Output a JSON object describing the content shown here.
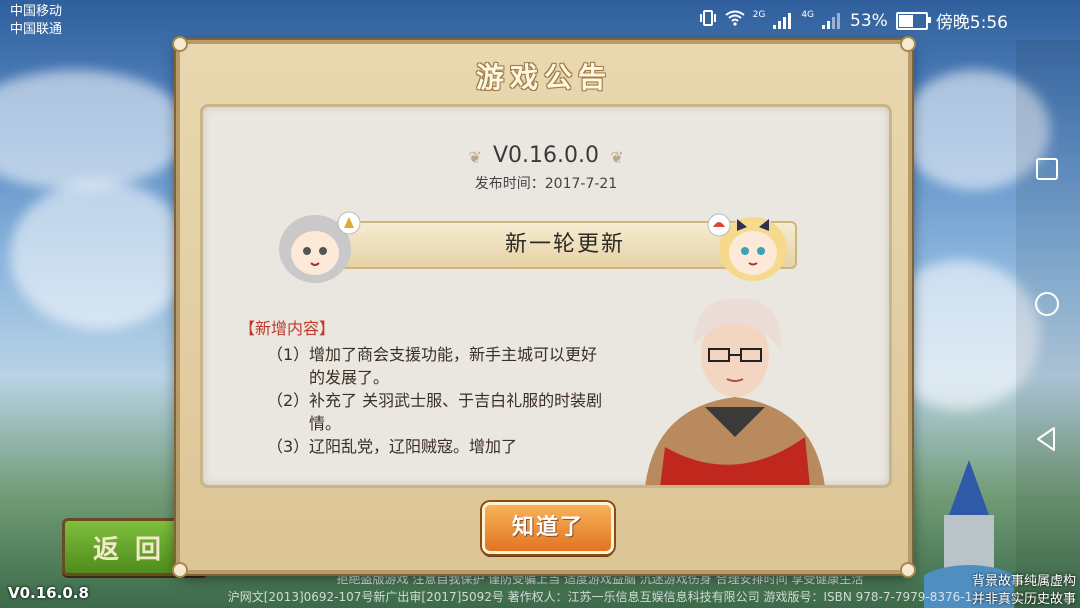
{
  "status_bar": {
    "carrier_1": "中国移动",
    "carrier_2": "中国联通",
    "network_1": "2G",
    "network_2": "4G",
    "battery": "53%",
    "time": "傍晚5:56",
    "icons": [
      "vibrate-icon",
      "wifi-icon",
      "signal-icon",
      "signal-icon",
      "battery-icon"
    ]
  },
  "dialog": {
    "title": "游戏公告",
    "version": "V0.16.0.0",
    "release_date": "发布时间：2017-7-21",
    "banner": "新一轮更新",
    "section_title": "【新增内容】",
    "items": [
      {
        "num": "（1）",
        "text": "增加了商会支援功能，新手主城可以更好的发展了。"
      },
      {
        "num": "（2）",
        "text": "补充了 关羽武士服、于吉白礼服的时装剧情。"
      },
      {
        "num": "（3）",
        "text": "辽阳乱党，辽阳贼寇。增加了"
      }
    ],
    "ok_label": "知道了"
  },
  "background": {
    "back_label": "返回",
    "version_corner": "V0.16.0.8",
    "footer_line1": "拒绝盗版游戏 注意自我保护 谨防受骗上当 适度游戏益脑 沉迷游戏伤身 合理安排时间 享受健康生活",
    "footer_line2": "沪网文[2013]0692-107号新广出审[2017]5092号 著作权人：江苏一乐信息互娱信息科技有限公司 游戏版号：ISBN 978-7-7979-8376-1",
    "story_line1": "背景故事纯属虚构",
    "story_line2": "并非真实历史故事"
  },
  "colors": {
    "dialog_bg": "#e9d8b0",
    "panel_bg": "#eae7e0",
    "section_red": "#c0392b",
    "ok_button": "#e27420",
    "back_button": "#4f8c1e"
  }
}
